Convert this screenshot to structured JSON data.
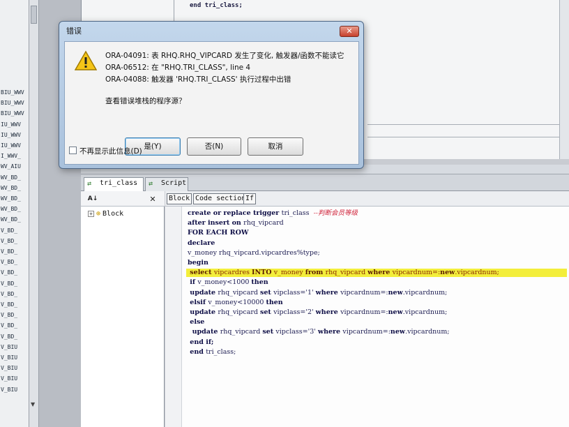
{
  "left_tree": {
    "items": [
      "BIU_WWV",
      "BIU_WWV",
      "BIU_WWV",
      "IU_WWV",
      "IU_WWV",
      "IU_WWV",
      "I_WWV_",
      "WV_AIU",
      "WV_BD_",
      "WV_BD_",
      "WV_BD_",
      "WV_BD_",
      "WV_BD_",
      "V_BD_",
      "V_BD_",
      "V_BD_",
      "V_BD_",
      "V_BD_",
      "V_BD_",
      "V_BD_",
      "V_BD_",
      "V_BD_",
      "V_BD_",
      "V_BD_",
      "V_BIU",
      "V_BIU",
      "V_BIU",
      "V_BIU",
      "V_BIU"
    ]
  },
  "upper_editor": {
    "code_fragment": "end tri_class;"
  },
  "error_dialog": {
    "title": "错误",
    "close_label": "✕",
    "messages": [
      "ORA-04091: 表 RHQ.RHQ_VIPCARD 发生了变化, 触发器/函数不能读它",
      "ORA-06512: 在 \"RHQ.TRI_CLASS\", line 4",
      "ORA-04088: 触发器 'RHQ.TRI_CLASS' 执行过程中出错"
    ],
    "question": "查看错误堆栈的程序源？",
    "buttons": {
      "yes": "是(Y)",
      "no": "否(N)",
      "cancel": "取消"
    },
    "dont_show_again": "不再显示此信息(D)",
    "icon": "warning-icon"
  },
  "bottom_panel": {
    "tabs": [
      {
        "label": "tri_class",
        "active": true
      },
      {
        "label": "Script",
        "active": false
      }
    ],
    "tree": {
      "sort_icon": "sort-az-icon",
      "close_label": "✕",
      "node_label": "Block"
    },
    "editor_toolbar": [
      "Block",
      "Code section",
      "If"
    ],
    "code_lines": [
      {
        "parts": [
          {
            "t": "create or replace trigger ",
            "k": true
          },
          {
            "t": "tri_class "
          },
          {
            "t": " --判断会员等级",
            "c": true
          }
        ]
      },
      {
        "parts": [
          {
            "t": "after insert on ",
            "k": true
          },
          {
            "t": "rhq_vipcard"
          }
        ]
      },
      {
        "parts": [
          {
            "t": "FOR EACH ROW",
            "k": true
          }
        ]
      },
      {
        "parts": [
          {
            "t": "declare",
            "k": true
          }
        ]
      },
      {
        "parts": [
          {
            "t": "v_money rhq_vipcard.vipcardres%type;"
          }
        ]
      },
      {
        "parts": [
          {
            "t": "begin",
            "k": true
          }
        ]
      },
      {
        "parts": [
          {
            "t": " select ",
            "k": true
          },
          {
            "t": "vipcardres "
          },
          {
            "t": "INTO ",
            "k": true
          },
          {
            "t": "v_money "
          },
          {
            "t": "from ",
            "k": true
          },
          {
            "t": "rhq_vipcard "
          },
          {
            "t": "where ",
            "k": true
          },
          {
            "t": "vipcardnum=:"
          },
          {
            "t": "new",
            "k": true
          },
          {
            "t": ".vipcardnum;"
          }
        ],
        "highlight": true
      },
      {
        "parts": [
          {
            "t": " if ",
            "k": true
          },
          {
            "t": "v_money<1000 "
          },
          {
            "t": "then",
            "k": true
          }
        ]
      },
      {
        "parts": [
          {
            "t": " update ",
            "k": true
          },
          {
            "t": "rhq_vipcard "
          },
          {
            "t": "set ",
            "k": true
          },
          {
            "t": "vipclass='1' "
          },
          {
            "t": "where ",
            "k": true
          },
          {
            "t": "vipcardnum=:"
          },
          {
            "t": "new",
            "k": true
          },
          {
            "t": ".vipcardnum;"
          }
        ]
      },
      {
        "parts": [
          {
            "t": " elsif ",
            "k": true
          },
          {
            "t": "v_money<10000 "
          },
          {
            "t": "then",
            "k": true
          }
        ]
      },
      {
        "parts": [
          {
            "t": " update ",
            "k": true
          },
          {
            "t": "rhq_vipcard "
          },
          {
            "t": "set ",
            "k": true
          },
          {
            "t": "vipclass='2' "
          },
          {
            "t": "where ",
            "k": true
          },
          {
            "t": "vipcardnum=:"
          },
          {
            "t": "new",
            "k": true
          },
          {
            "t": ".vipcardnum;"
          }
        ]
      },
      {
        "parts": [
          {
            "t": " else",
            "k": true
          }
        ]
      },
      {
        "parts": [
          {
            "t": "  update ",
            "k": true
          },
          {
            "t": "rhq_vipcard "
          },
          {
            "t": "set ",
            "k": true
          },
          {
            "t": "vipclass='3' "
          },
          {
            "t": "where ",
            "k": true
          },
          {
            "t": "vipcardnum=:"
          },
          {
            "t": "new",
            "k": true
          },
          {
            "t": ".vipcardnum;"
          }
        ]
      },
      {
        "parts": [
          {
            "t": " end if;",
            "k": true
          }
        ]
      },
      {
        "parts": [
          {
            "t": " end ",
            "k": true
          },
          {
            "t": "tri_class;"
          }
        ]
      }
    ]
  },
  "colors": {
    "highlight": "#f3ee3b",
    "comment": "#d0233a",
    "dialog_frame": "#a9c1dc"
  }
}
